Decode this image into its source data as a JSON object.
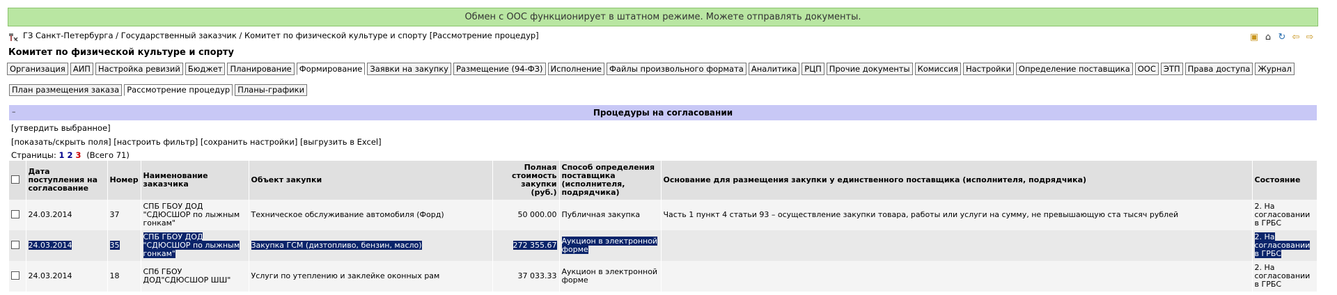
{
  "banner": {
    "text": "Обмен с ООС функционирует в штатном режиме. Можете отправлять документы."
  },
  "breadcrumb": {
    "text": "ГЗ Санкт-Петербурга / Государственный заказчик / Комитет по физической культуре и спорту [Рассмотрение процедур]"
  },
  "page_title": "Комитет по физической культуре и спорту",
  "main_tabs": [
    "Организация",
    "АИП",
    "Настройка ревизий",
    "Бюджет",
    "Планирование",
    "Формирование",
    "Заявки на закупку",
    "Размещение (94-ФЗ)",
    "Исполнение",
    "Файлы произвольного формата",
    "Аналитика",
    "РЦП",
    "Прочие документы",
    "Комиссия",
    "Настройки",
    "Определение поставщика",
    "ООС",
    "ЭТП",
    "Права доступа",
    "Журнал"
  ],
  "sub_tabs": [
    "План размещения заказа",
    "Рассмотрение процедур",
    "Планы-графики"
  ],
  "section": {
    "collapse": "–",
    "title": "Процедуры на согласовании"
  },
  "links": {
    "approve": "[утвердить выбранное]",
    "toggle_fields": "[показать/скрыть поля]",
    "filter": "[настроить фильтр]",
    "save": "[сохранить настройки]",
    "excel": "[выгрузить в Excel]"
  },
  "pages": {
    "label": "Страницы:",
    "p1": "1",
    "p2": "2",
    "p3": "3",
    "total": "(Всего 71)"
  },
  "table": {
    "headers": {
      "date": "Дата поступления на согласование",
      "number": "Номер",
      "customer": "Наименование заказчика",
      "object": "Объект закупки",
      "cost": "Полная стоимость закупки (руб.)",
      "method": "Способ определения поставщика (исполнителя, подрядчика)",
      "basis": "Основание для размещения закупки у единственного поставщика (исполнителя, подрядчика)",
      "status": "Состояние"
    },
    "rows": [
      {
        "date": "24.03.2014",
        "number": "37",
        "customer": "СПБ ГБОУ ДОД \"СДЮСШОР по лыжным гонкам\"",
        "object": "Техническое обслуживание автомобиля (Форд)",
        "cost": "50 000.00",
        "method": "Публичная закупка",
        "basis": "Часть 1 пункт 4 статьи 93 – осуществление закупки товара, работы или услуги на сумму, не превышающую ста тысяч рублей",
        "status": "2. На согласовании в ГРБС"
      },
      {
        "date": "24.03.2014",
        "number": "35",
        "customer": "СПБ ГБОУ ДОД \"СДЮСШОР по лыжным гонкам\"",
        "object": "Закупка ГСМ (дизтопливо, бензин, масло)",
        "cost": "272 355.67",
        "method": "Аукцион в электронной форме",
        "basis": "",
        "status": "2. На согласовании в ГРБС"
      },
      {
        "date": "24.03.2014",
        "number": "18",
        "customer": "СПб ГБОУ ДОД\"СДЮСШОР ШШ\"",
        "object": "Услуги по утеплению и заклейке оконных рам",
        "cost": "37 033.33",
        "method": "Аукцион в электронной форме",
        "basis": "",
        "status": "2. На согласовании в ГРБС"
      }
    ]
  },
  "colors": {
    "banner_bg": "#b9e6a2",
    "header_bg": "#c8c8f6",
    "selection": "#0a246a"
  }
}
